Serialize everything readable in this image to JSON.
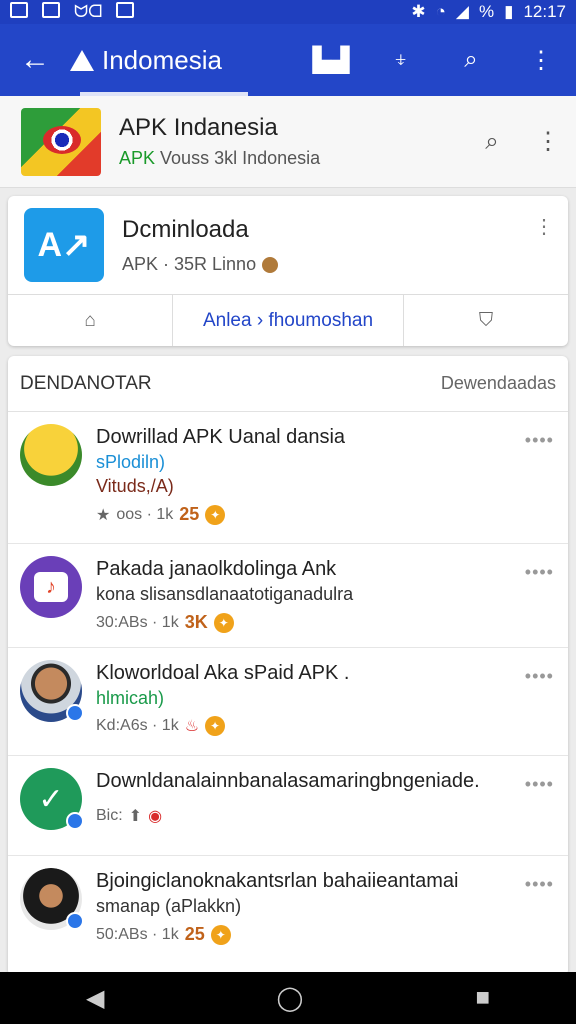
{
  "status": {
    "battery": "%",
    "time": "12:17"
  },
  "appbar": {
    "title": "Indomesia",
    "back_icon": "arrow-left-icon",
    "actions": [
      "bookmark-icon",
      "share-icon",
      "search-icon",
      "more-vert-icon"
    ]
  },
  "site": {
    "title": "APK Indanesia",
    "sub_green": "APK",
    "sub_rest": " Vouss 3kl Indonesia"
  },
  "app": {
    "name": "Dcminloada",
    "meta": "APK · 35R Linno",
    "tabs": [
      "",
      "Anlea › fhoumoshan",
      ""
    ]
  },
  "list": {
    "header_left": "DENDANOTAR",
    "header_right": "Dewendaadas",
    "items": [
      {
        "title": "Dowrillad APK Uanal dansia",
        "sub1": "sPlodiln)",
        "sub1_color": "#1a8fd6",
        "sub2": "Vituds,/A)",
        "sub2_color": "#7a2a1a",
        "meta": "oos · 1k",
        "num": "25"
      },
      {
        "title": "Pakada janaolkdolinga Ank",
        "sub1": "kona slisansdlanaatotiganadulra",
        "sub1_color": "#333333",
        "sub2": "",
        "sub2_color": "#333333",
        "meta": "30:ABs · 1k",
        "num": "3K"
      },
      {
        "title": "Kloworldoal Aka sPaid APK .",
        "sub1": "hlmicah)",
        "sub1_color": "#1a9a4a",
        "sub2": "",
        "sub2_color": "#333333",
        "meta": "Kd:A6s · 1k",
        "num": ""
      },
      {
        "title": "Downldanalainnbanalasamaringbngeniade.",
        "sub1": "",
        "sub1_color": "#333333",
        "sub2": "",
        "sub2_color": "#333333",
        "meta": "Bic:",
        "num": ""
      },
      {
        "title": "Bjoingiclanoknakantsrlan bahaiieantamai",
        "sub1": "smanap (aPlakkn)",
        "sub1_color": "#333333",
        "sub2": "",
        "sub2_color": "#333333",
        "meta": "50:ABs · 1k",
        "num": "25"
      }
    ]
  },
  "colors": {
    "primary": "#2346c8",
    "accent": "#f0a21a",
    "green": "#1a9a2a"
  }
}
